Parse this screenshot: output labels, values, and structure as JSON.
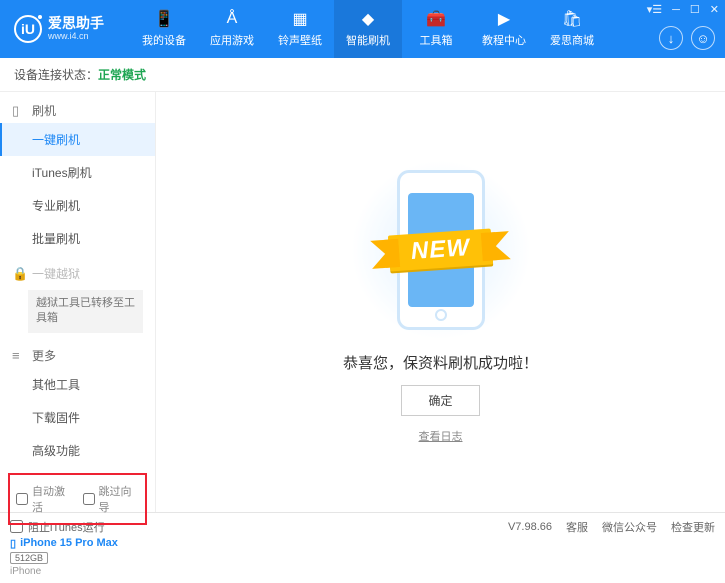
{
  "header": {
    "logo_char": "iU",
    "title": "爱思助手",
    "subtitle": "www.i4.cn",
    "nav": [
      {
        "label": "我的设备"
      },
      {
        "label": "应用游戏"
      },
      {
        "label": "铃声壁纸"
      },
      {
        "label": "智能刷机"
      },
      {
        "label": "工具箱"
      },
      {
        "label": "教程中心"
      },
      {
        "label": "爱思商城"
      }
    ]
  },
  "status": {
    "label": "设备连接状态：",
    "mode": "正常模式"
  },
  "sidebar": {
    "sec_flash": "刷机",
    "items_flash": [
      "一键刷机",
      "iTunes刷机",
      "专业刷机",
      "批量刷机"
    ],
    "sec_jail": "一键越狱",
    "jail_note": "越狱工具已转移至工具箱",
    "sec_more": "更多",
    "items_more": [
      "其他工具",
      "下载固件",
      "高级功能"
    ],
    "chk_auto": "自动激活",
    "chk_skip": "跳过向导",
    "device_name": "iPhone 15 Pro Max",
    "storage": "512GB",
    "device_type": "iPhone"
  },
  "main": {
    "ribbon": "NEW",
    "message": "恭喜您，保资料刷机成功啦！",
    "ok": "确定",
    "view_log": "查看日志"
  },
  "footer": {
    "block_itunes": "阻止iTunes运行",
    "version": "V7.98.66",
    "links": [
      "客服",
      "微信公众号",
      "检查更新"
    ]
  }
}
